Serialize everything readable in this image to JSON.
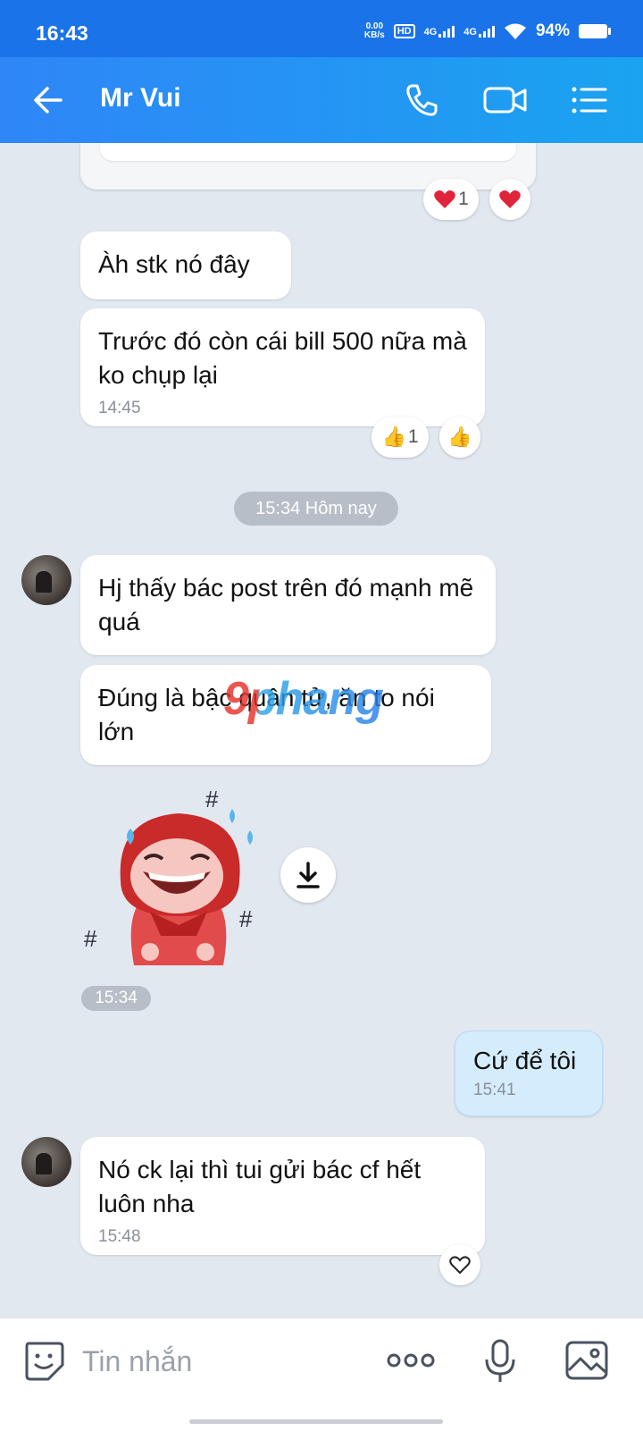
{
  "status_bar": {
    "time": "16:43",
    "net_speed_value": "0.00",
    "net_speed_unit": "KB/s",
    "hd_badge": "HD",
    "sim1_label": "4G",
    "sim2_label": "4G",
    "battery_percent": "94%"
  },
  "header": {
    "contact_name": "Mr Vui"
  },
  "messages": {
    "m1_text": "Àh stk nó đây",
    "m2_text": "Trước đó còn cái bill 500 nữa mà ko chụp lại",
    "m2_time": "14:45",
    "date_divider": "15:34 Hôm nay",
    "m3_text": "Hj thấy bác post trên đó mạnh mẽ quá",
    "m4_text": "Đúng là bậc quân tử, ăn to nói lớn",
    "sticker_time": "15:34",
    "m5_text": "Cứ để tôi",
    "m5_time": "15:41",
    "m6_text": "Nó ck lại thì tui gửi bác cf hết luôn nha",
    "m6_time": "15:48"
  },
  "reactions": {
    "top_heart_count": "1",
    "like_count": "1"
  },
  "watermark": "9phang",
  "composer": {
    "placeholder": "Tin nhắn"
  },
  "colors": {
    "header_start": "#2f86f7",
    "header_end": "#1aa3f0",
    "chat_background": "#e2e8f0",
    "outgoing_bubble": "#d4ecfb",
    "heart": "#e0243a"
  },
  "icons": [
    "back-arrow-icon",
    "phone-icon",
    "video-call-icon",
    "menu-list-icon",
    "heart-icon",
    "thumbs-up-icon",
    "download-icon",
    "sticker-icon",
    "more-icon",
    "microphone-icon",
    "image-icon"
  ]
}
